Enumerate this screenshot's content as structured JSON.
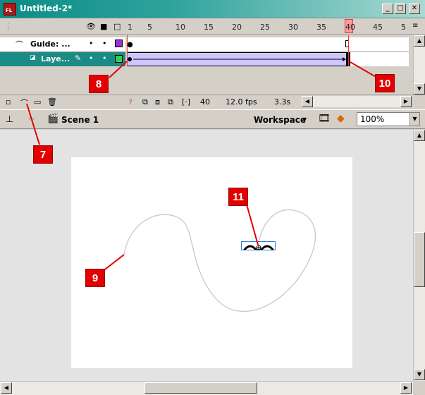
{
  "window": {
    "title": "Untitled-2*"
  },
  "timeline": {
    "frame_numbers": [
      "1",
      "5",
      "10",
      "15",
      "20",
      "25",
      "30",
      "35",
      "40",
      "45",
      "5"
    ],
    "layers": [
      {
        "name": "Guide: ..."
      },
      {
        "name": "Laye..."
      }
    ],
    "footer": {
      "current_frame": "40",
      "fps": "12.0 fps",
      "time": "3.3s"
    }
  },
  "scenebar": {
    "scene": "Scene 1",
    "workspace": "Workspace",
    "zoom": "100%"
  },
  "callouts": {
    "c7": "7",
    "c8": "8",
    "c9": "9",
    "c10": "10",
    "c11": "11"
  },
  "colors": {
    "accent": "#1a8b85",
    "callout": "#e20000",
    "tween": "#cdc6ff",
    "playhead": "#ff9999"
  }
}
